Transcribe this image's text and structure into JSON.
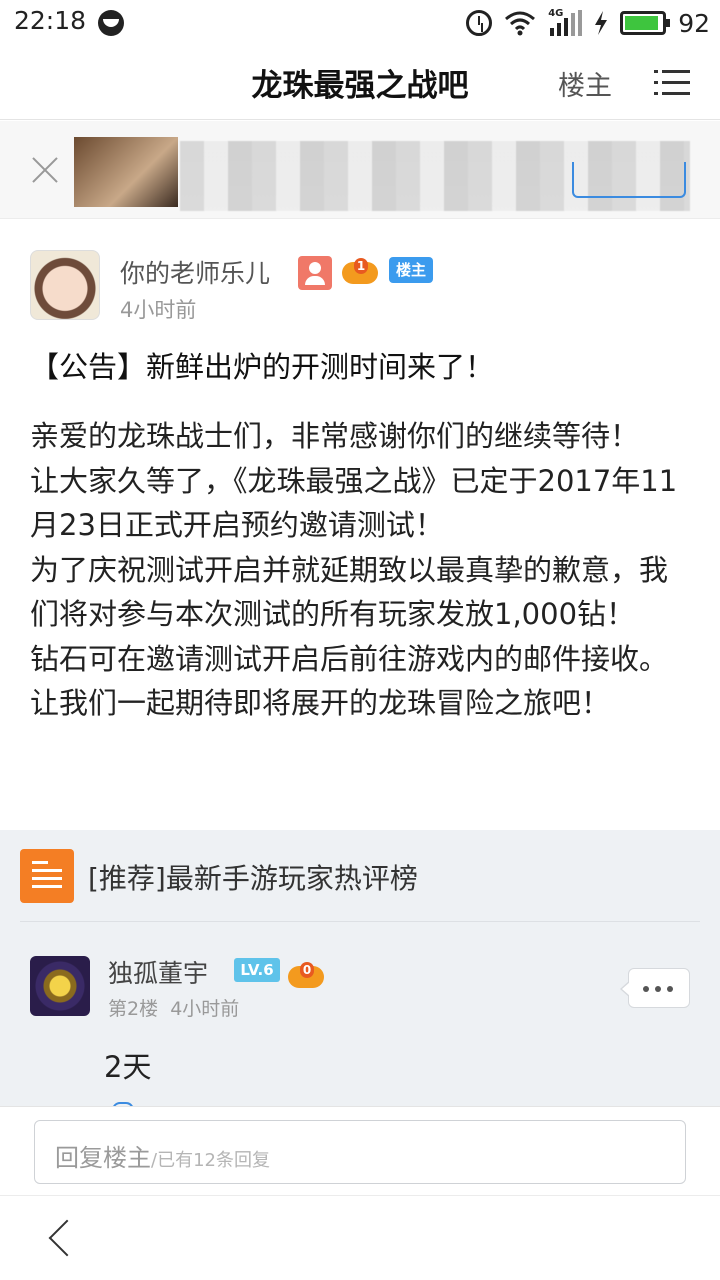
{
  "status_bar": {
    "time": "22:18",
    "network": "4G",
    "battery_percent": "92",
    "battery_level": 0.92
  },
  "header": {
    "title": "龙珠最强之战吧",
    "owner_link": "楼主"
  },
  "post": {
    "author": "你的老师乐儿",
    "gamepad_level": "1",
    "op_badge": "楼主",
    "time": "4小时前",
    "title": "【公告】新鲜出炉的开测时间来了！",
    "body": [
      "亲爱的龙珠战士们，非常感谢你们的继续等待！",
      "让大家久等了，《龙珠最强之战》已定于2017年11月23日正式开启预约邀请测试！",
      "为了庆祝测试开启并就延期致以最真挚的歉意，我们将对参与本次测试的所有玩家发放1,000钻！",
      "钻石可在邀请测试开启后前往游戏内的邮件接收。",
      "让我们一起期待即将展开的龙珠冒险之旅吧！"
    ]
  },
  "recommend": {
    "text": "[推荐]最新手游玩家热评榜"
  },
  "floor": {
    "author": "独孤董宇",
    "level_badge": "LV.6",
    "gamepad_level": "0",
    "floor_number": "第2楼",
    "time": "4小时前",
    "content": "2天"
  },
  "reply_bar": {
    "placeholder": "回复楼主",
    "reply_count": "/已有12条回复"
  },
  "icons": {
    "status_face": "status-indicator-icon",
    "alarm": "alarm-icon",
    "wifi": "wifi-icon",
    "signal": "signal-icon",
    "charging": "charging-bolt-icon",
    "battery": "battery-icon",
    "menu": "menu-icon",
    "close": "close-icon",
    "user": "user-icon",
    "gamepad": "gamepad-icon",
    "recommend": "list-icon",
    "more": "more-icon",
    "back": "back-arrow-icon"
  },
  "colors": {
    "op_badge": "#3b9bee",
    "recommend_icon": "#f47e24",
    "level_badge": "#5fc3ea",
    "battery_fill": "#3ec53e",
    "reply_area_bg": "#eef1f4"
  }
}
